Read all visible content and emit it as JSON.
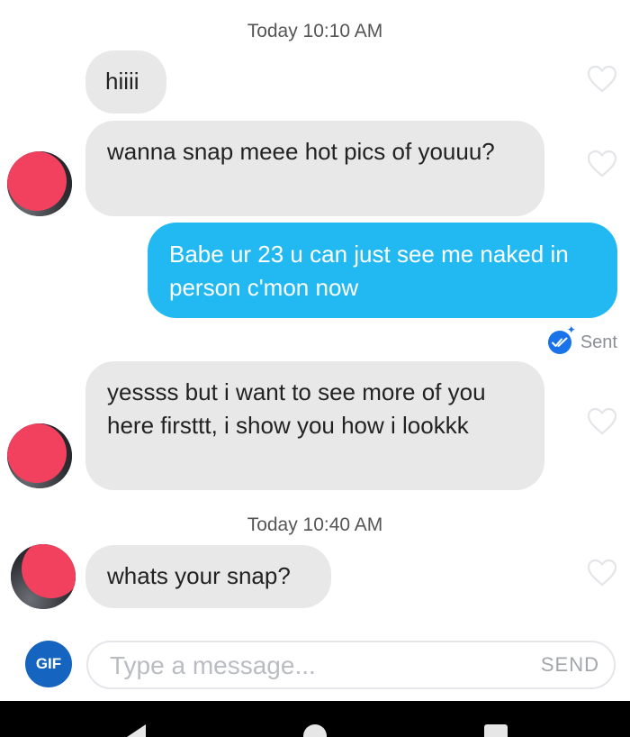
{
  "timestamps": [
    "Today 10:10 AM",
    "Today 10:40 AM"
  ],
  "messages": [
    {
      "direction": "incoming",
      "text": "hiiii"
    },
    {
      "direction": "incoming",
      "text": "wanna snap meee hot pics of youuu?"
    },
    {
      "direction": "outgoing",
      "text": "Babe ur 23 u can just see me naked in person c'mon now"
    },
    {
      "direction": "incoming",
      "text": "yessss but i want to see more of you here firsttt, i show you how i lookkk"
    },
    {
      "direction": "incoming",
      "text": "whats your snap?"
    }
  ],
  "status": {
    "sent_label": "Sent"
  },
  "composer": {
    "gif_label": "GIF",
    "placeholder": "Type a message...",
    "send_label": "SEND"
  },
  "icons": {
    "like": "heart-outline-icon",
    "sent": "double-check-icon",
    "nav": [
      "back-icon",
      "home-icon",
      "recents-icon"
    ]
  },
  "colors": {
    "outgoing_bubble": "#22b9f3",
    "incoming_bubble": "#e8e8e8",
    "gif_button": "#1565c0",
    "sent_badge": "#1a73e8"
  }
}
